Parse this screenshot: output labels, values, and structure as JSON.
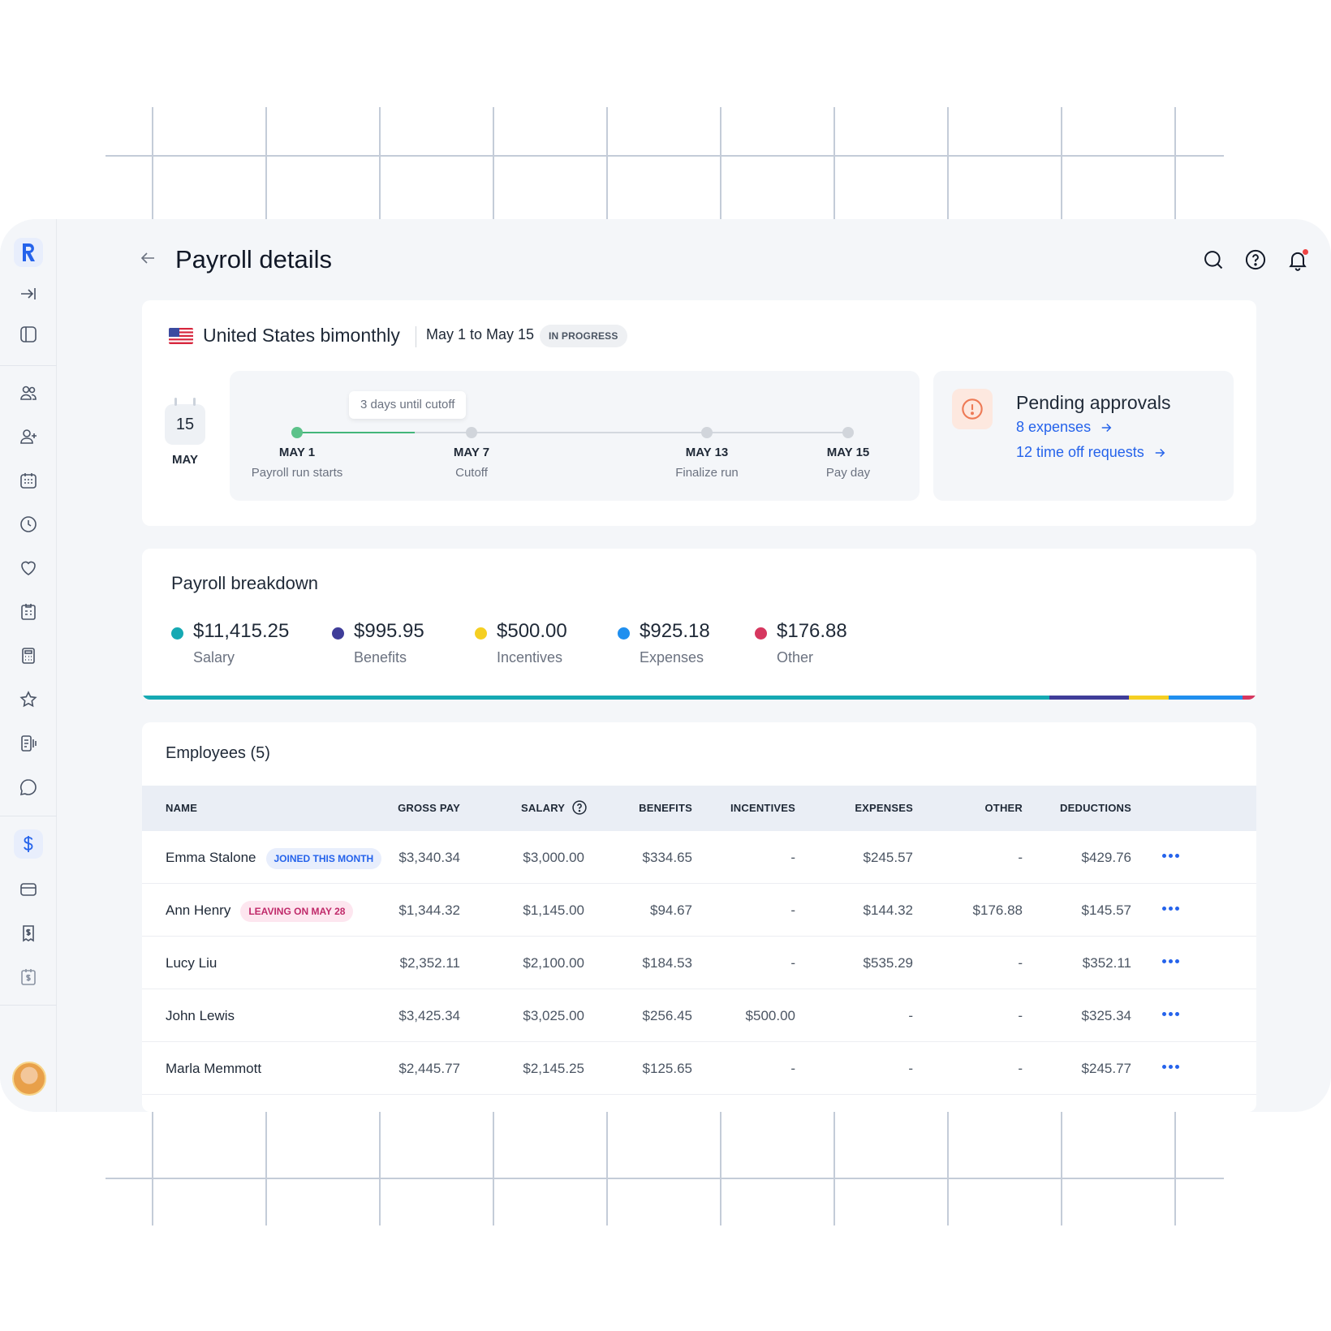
{
  "header": {
    "title": "Payroll details"
  },
  "run": {
    "country_name": "United States bimonthly",
    "period": "May 1 to May 15",
    "status": "IN PROGRESS"
  },
  "calendar": {
    "day": "15",
    "month": "MAY"
  },
  "timeline": {
    "tooltip": "3 days until cutoff",
    "steps": [
      {
        "date": "MAY 1",
        "label": "Payroll run starts"
      },
      {
        "date": "MAY 7",
        "label": "Cutoff"
      },
      {
        "date": "MAY 13",
        "label": "Finalize run"
      },
      {
        "date": "MAY 15",
        "label": "Pay day"
      }
    ]
  },
  "approvals": {
    "title": "Pending approvals",
    "expenses_link": "8 expenses",
    "timeoff_link": "12 time off requests"
  },
  "breakdown": {
    "title": "Payroll breakdown",
    "items": [
      {
        "value": "$11,415.25",
        "label": "Salary",
        "color": "#16a9b3"
      },
      {
        "value": "$995.95",
        "label": "Benefits",
        "color": "#3f3d99"
      },
      {
        "value": "$500.00",
        "label": "Incentives",
        "color": "#f5cf22"
      },
      {
        "value": "$925.18",
        "label": "Expenses",
        "color": "#1f8fef"
      },
      {
        "value": "$176.88",
        "label": "Other",
        "color": "#d6375f"
      }
    ]
  },
  "employees": {
    "title": "Employees (5)",
    "columns": {
      "name": "NAME",
      "gross": "GROSS PAY",
      "salary": "SALARY",
      "benefits": "BENEFITS",
      "incentives": "INCENTIVES",
      "expenses": "EXPENSES",
      "other": "OTHER",
      "deductions": "DEDUCTIONS"
    },
    "rows": [
      {
        "name": "Emma Stalone",
        "tag": "JOINED THIS MONTH",
        "gross": "$3,340.34",
        "salary": "$3,000.00",
        "benefits": "$334.65",
        "incentives": "-",
        "expenses": "$245.57",
        "other": "-",
        "deductions": "$429.76"
      },
      {
        "name": "Ann Henry",
        "tag": "LEAVING ON MAY 28",
        "gross": "$1,344.32",
        "salary": "$1,145.00",
        "benefits": "$94.67",
        "incentives": "-",
        "expenses": "$144.32",
        "other": "$176.88",
        "deductions": "$145.57"
      },
      {
        "name": "Lucy Liu",
        "gross": "$2,352.11",
        "salary": "$2,100.00",
        "benefits": "$184.53",
        "incentives": "-",
        "expenses": "$535.29",
        "other": "-",
        "deductions": "$352.11"
      },
      {
        "name": "John Lewis",
        "gross": "$3,425.34",
        "salary": "$3,025.00",
        "benefits": "$256.45",
        "incentives": "$500.00",
        "expenses": "-",
        "other": "-",
        "deductions": "$325.34"
      },
      {
        "name": "Marla Memmott",
        "gross": "$2,445.77",
        "salary": "$2,145.25",
        "benefits": "$125.65",
        "incentives": "-",
        "expenses": "-",
        "other": "-",
        "deductions": "$245.77"
      }
    ]
  }
}
